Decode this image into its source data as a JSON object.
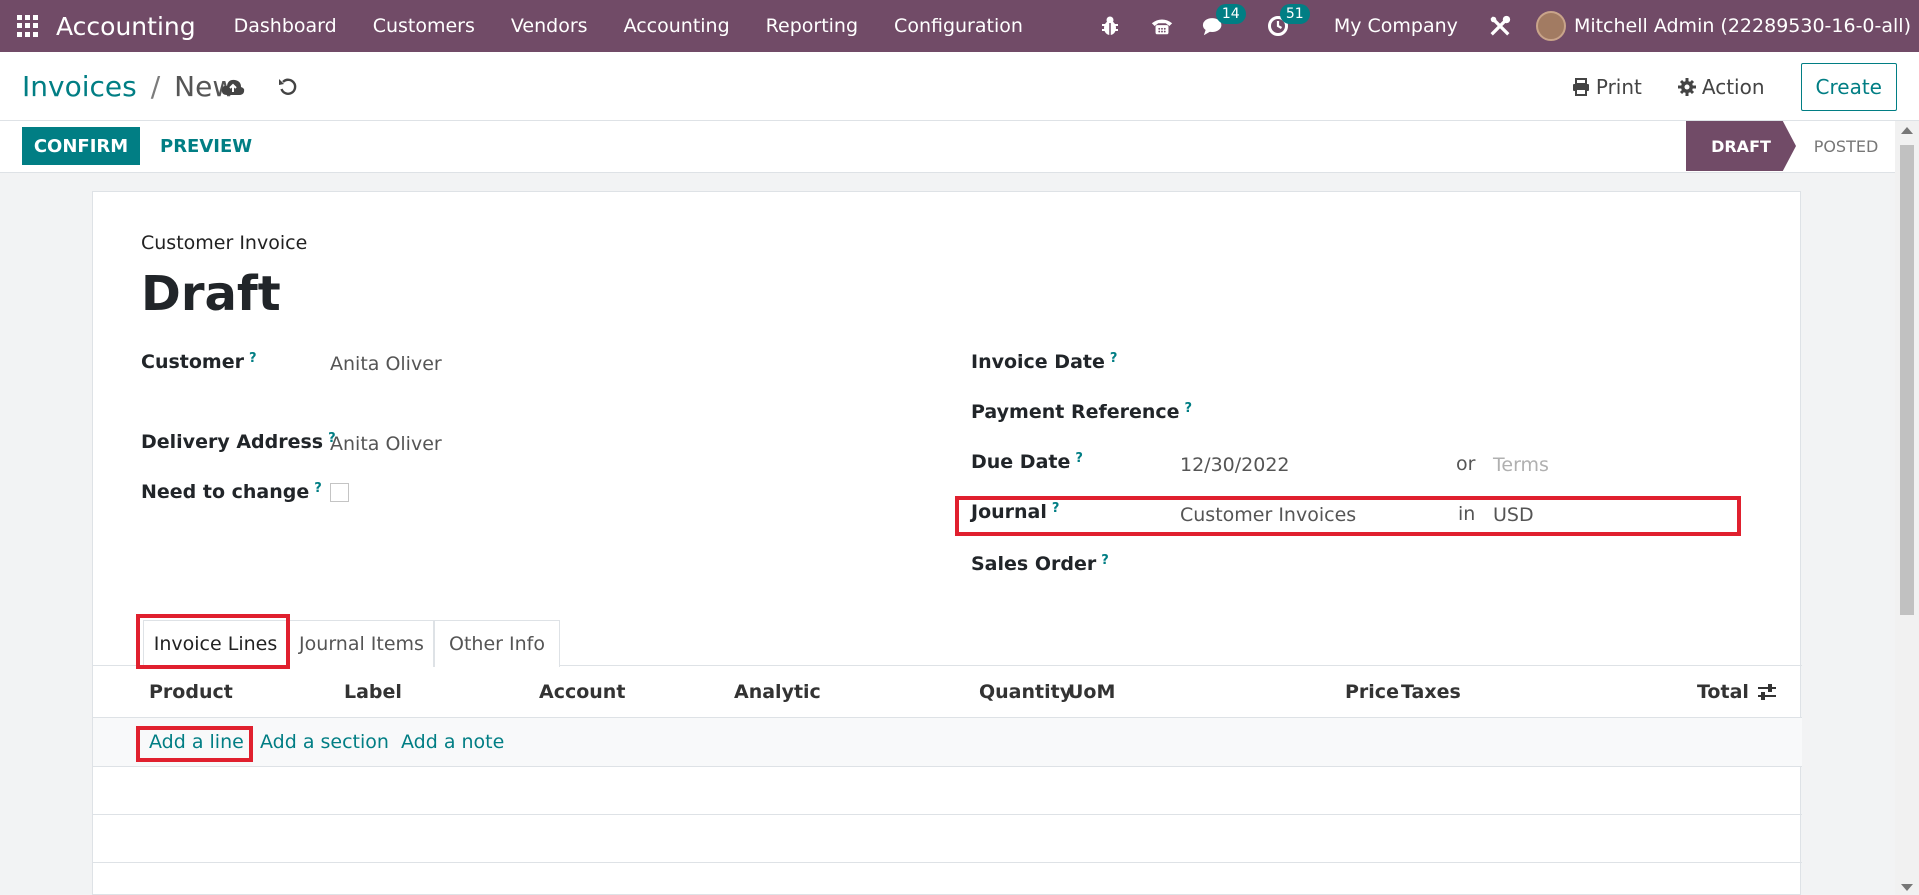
{
  "navbar": {
    "app_name": "Accounting",
    "menu": [
      "Dashboard",
      "Customers",
      "Vendors",
      "Accounting",
      "Reporting",
      "Configuration"
    ],
    "messages_badge": "14",
    "activities_badge": "51",
    "company": "My Company",
    "user": "Mitchell Admin (22289530-16-0-all)"
  },
  "control_panel": {
    "breadcrumb_parent": "Invoices",
    "breadcrumb_separator": "/",
    "breadcrumb_current": "New",
    "print_label": "Print",
    "action_label": "Action",
    "create_label": "Create"
  },
  "statusbar": {
    "confirm_label": "CONFIRM",
    "preview_label": "PREVIEW",
    "stage_draft": "DRAFT",
    "stage_posted": "POSTED"
  },
  "form": {
    "subtitle": "Customer Invoice",
    "title": "Draft",
    "customer_label": "Customer",
    "customer_value": "Anita Oliver",
    "delivery_label": "Delivery Address",
    "delivery_value": "Anita Oliver",
    "need_change_label": "Need to change",
    "invoice_date_label": "Invoice Date",
    "payment_ref_label": "Payment Reference",
    "due_date_label": "Due Date",
    "due_date_value": "12/30/2022",
    "or_text": "or",
    "terms_placeholder": "Terms",
    "journal_label": "Journal",
    "journal_value": "Customer Invoices",
    "in_text": "in",
    "currency_value": "USD",
    "sales_order_label": "Sales Order",
    "help_mark": "?"
  },
  "tabs": [
    "Invoice Lines",
    "Journal Items",
    "Other Info"
  ],
  "table": {
    "columns": [
      "Product",
      "Label",
      "Account",
      "Analytic",
      "Quantity",
      "UoM",
      "Price",
      "Taxes",
      "Total"
    ],
    "add_line": "Add a line",
    "add_section": "Add a section",
    "add_note": "Add a note"
  },
  "colors": {
    "brand": "#714b67",
    "accent": "#017e84",
    "highlight": "#e0202e"
  }
}
